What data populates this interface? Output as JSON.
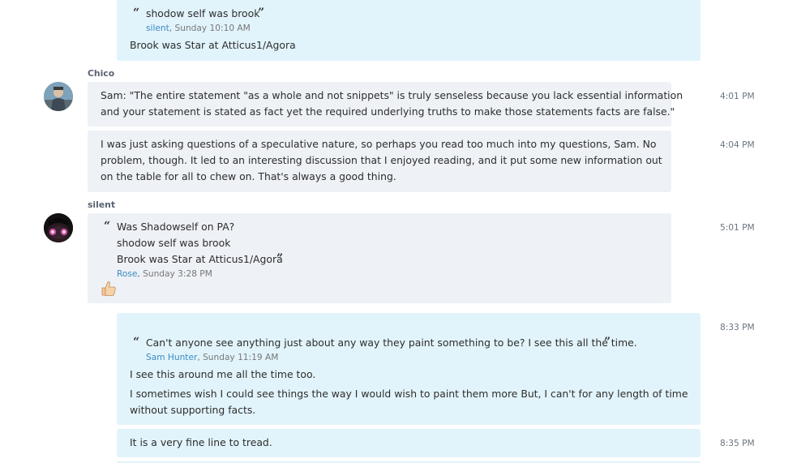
{
  "messages": {
    "m0": {
      "quote_text": "shodow self was brook",
      "quote_author": "silent",
      "quote_time": ", Sunday 10:10 AM",
      "body": "Brook was Star at Atticus1/Agora"
    },
    "chico": {
      "sender": "Chico",
      "m1": {
        "line1": "Sam: \"The entire statement \"as a whole and not snippets\" is truly senseless because you lack essential information",
        "line2": "and your statement is stated as fact yet the required underlying truths to make those statements facts are false.\"",
        "time": "4:01 PM"
      },
      "m2": {
        "line1": "I was just asking questions of a speculative nature, so perhaps you read too much into my questions, Sam.  No",
        "line2": "problem, though.  It led to an interesting discussion that I enjoyed reading, and it put some new information out",
        "line3": "on the table for all to chew on.  That's always a good thing.",
        "time": "4:04 PM"
      }
    },
    "silent": {
      "sender": "silent",
      "m3": {
        "quote_line1": "Was Shadowself on PA?",
        "quote_line2": "shodow self was brook",
        "quote_line3": "Brook was Star at Atticus1/Agora",
        "quote_author": "Rose",
        "quote_time": ", Sunday 3:28 PM",
        "reaction": "thumbs-up",
        "time": "5:01 PM"
      }
    },
    "m4": {
      "quote_text": "Can't anyone see anything just about any way they paint something to be?  I see this all the time.",
      "quote_author": "Sam Hunter",
      "quote_time": ", Sunday 11:19 AM",
      "body1": "I see this around me all the time too.",
      "body2_line1": "I sometimes wish I could see things the way I would wish to paint them more  But, I can't for any length of time",
      "body2_line2": "without supporting facts.",
      "time": "8:33 PM"
    },
    "m5": {
      "body": "It is a very fine line to tread.",
      "time": "8:35 PM"
    },
    "glyphs": {
      "open_quote": "“",
      "close_quote": "”"
    },
    "colors": {
      "outgoing_bubble": "#e2f4fb",
      "incoming_bubble": "#eef1f6",
      "quote_author_link": "#3a8bc4"
    }
  }
}
